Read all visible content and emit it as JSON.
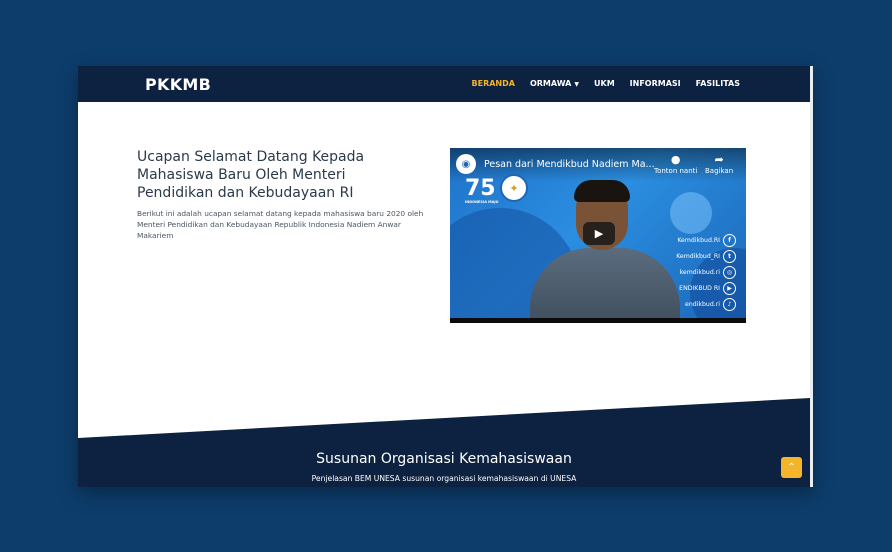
{
  "header": {
    "brand": "PKKMB",
    "nav": [
      {
        "label": "BERANDA",
        "active": true
      },
      {
        "label": "ORMAWA",
        "dropdown": true
      },
      {
        "label": "UKM"
      },
      {
        "label": "INFORMASI"
      },
      {
        "label": "FASILITAS"
      }
    ]
  },
  "hero": {
    "title": "Ucapan Selamat Datang Kepada Mahasiswa Baru Oleh Menteri Pendidikan dan Kebudayaan RI",
    "description": "Berikut ini adalah ucapan selamat datang kepada mahasiswa baru 2020 oleh Menteri Pendidikan dan Kebudayaan Republik Indonesia Nadiem Anwar Makariem"
  },
  "video": {
    "title": "Pesan dari Mendikbud Nadiem Ma...",
    "watch_later": "Tonton nanti",
    "share": "Bagikan",
    "logo_text": "75",
    "logo_sub": "INDONESIA MAJU",
    "socials": [
      {
        "label": "Kemdikbud.RI",
        "icon": "f"
      },
      {
        "label": "Kemdikbud_RI",
        "icon": "t"
      },
      {
        "label": "kemdikbud.ri",
        "icon": "◎"
      },
      {
        "label": "ENDIKBUD RI",
        "icon": "▶"
      },
      {
        "label": "endikbud.ri",
        "icon": "♪"
      }
    ]
  },
  "section": {
    "title": "Susunan Organisasi Kemahasiswaan",
    "subtitle": "Penjelasan BEM UNESA susunan organisasi kemahasiswaan di UNESA"
  },
  "colors": {
    "page_bg": "#0d3d6b",
    "navbar": "#0d2240",
    "accent": "#f4b52b"
  }
}
